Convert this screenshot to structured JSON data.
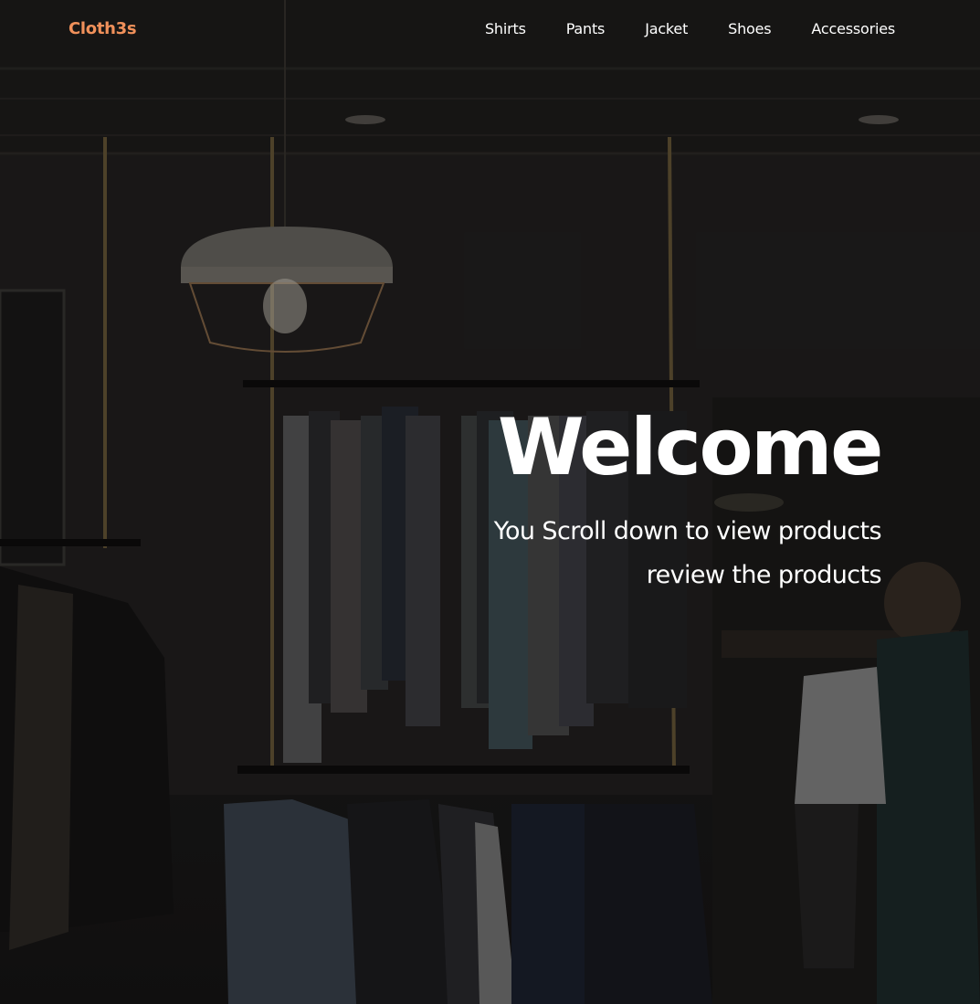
{
  "brand": {
    "name": "Cloth3s",
    "color": "#f0905a"
  },
  "nav": {
    "items": [
      {
        "label": "Shirts"
      },
      {
        "label": "Pants"
      },
      {
        "label": "Jacket"
      },
      {
        "label": "Shoes"
      },
      {
        "label": "Accessories"
      }
    ]
  },
  "hero": {
    "title": "Welcome",
    "subtitle_line1": "You Scroll down to view products",
    "subtitle_line2": "review the products",
    "background": "clothing-store-interior-photo"
  }
}
